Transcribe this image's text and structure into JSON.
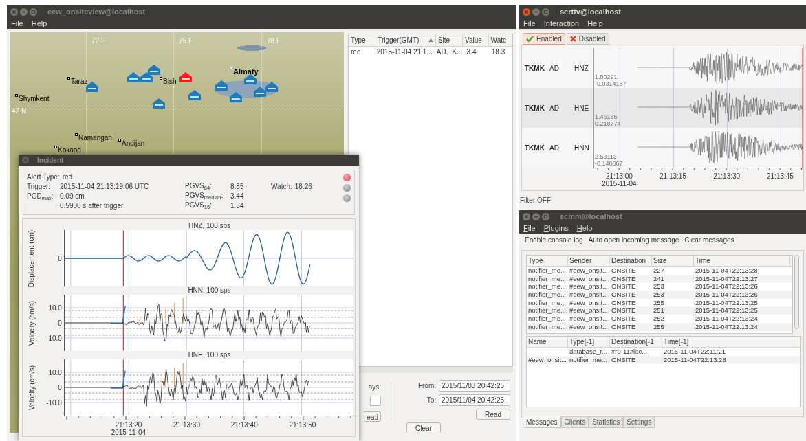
{
  "onsiteview": {
    "title": "eew_onsiteview@localhost",
    "active": false,
    "menu": [
      "File",
      "Help"
    ],
    "map": {
      "grid_labels": [
        "72 E",
        "75 E",
        "78 E",
        "42 N"
      ],
      "cities": [
        {
          "name": "Taraz",
          "capital": false
        },
        {
          "name": "Shymkent",
          "capital": false
        },
        {
          "name": "Bish",
          "capital": false
        },
        {
          "name": "Almaty",
          "capital": true
        },
        {
          "name": "Namangan",
          "capital": false
        },
        {
          "name": "Andijan",
          "capital": false
        },
        {
          "name": "Kokand",
          "capital": false
        }
      ],
      "stations": [
        {
          "color": "#1b7dc0"
        },
        {
          "color": "#1b7dc0"
        },
        {
          "color": "#1b7dc0"
        },
        {
          "color": "#1b7dc0"
        },
        {
          "color": "#ff1a1a"
        },
        {
          "color": "#1b7dc0"
        },
        {
          "color": "#1b7dc0"
        },
        {
          "color": "#1b7dc0"
        },
        {
          "color": "#1b7dc0"
        },
        {
          "color": "#1b7dc0"
        },
        {
          "color": "#1b7dc0"
        },
        {
          "color": "#1b7dc0"
        }
      ]
    },
    "table": {
      "columns": [
        {
          "label": "Type",
          "sorted": false
        },
        {
          "label": "Trigger(GMT)",
          "sorted": true
        },
        {
          "label": "Site",
          "sorted": false
        },
        {
          "label": "Value",
          "sorted": false
        },
        {
          "label": "Watc",
          "sorted": false
        }
      ],
      "rows": [
        [
          "red",
          "2015-11-04 21:1...",
          "AD.TK...",
          "3.4",
          "18.3"
        ]
      ]
    },
    "days_label": "ays:",
    "read_cut": "ead",
    "from_label": "From:",
    "from_value": "2015/11/03 20:42:25",
    "to_label": "To:",
    "to_value": "2015/11/04 20:42:25",
    "read_button": "Read",
    "clear_button": "Clear"
  },
  "incident": {
    "title": "Incident",
    "alert_type_label": "Alert Type:",
    "alert_type": "red",
    "trigger_label": "Trigger:",
    "trigger": "2015-11-04 21:13:19.06 UTC",
    "pgd_label": "PGD$_{max}$:",
    "pgd": "0.09 cm",
    "pgd_time": "0.5900 s after trigger",
    "pgvs": [
      {
        "label": "PGVS$_{84}$:",
        "value": "8.85"
      },
      {
        "label": "PGVS$_{median}$:",
        "value": "3.44"
      },
      {
        "label": "PGVS$_{16}$:",
        "value": "1.34"
      }
    ],
    "watch_label": "Watch:",
    "watch": "18.26",
    "lights": [
      {
        "on": true
      },
      {
        "on": false
      },
      {
        "on": false
      }
    ],
    "plots": [
      {
        "kind": "displacement",
        "title": "HNZ, 100 sps",
        "ylabel": "Displacement (cm)",
        "yticks": [
          "0"
        ]
      },
      {
        "kind": "velocity",
        "title": "HNN, 100 sps",
        "ylabel": "Velocity (cm/s)",
        "yticks": [
          "10.0",
          "0",
          "-10.0"
        ]
      },
      {
        "kind": "velocity",
        "title": "HNE, 100 sps",
        "ylabel": "Velocity (cm/s)",
        "yticks": [
          "10.0",
          "0",
          "-10.0"
        ]
      }
    ],
    "time_ticks": [
      "21:13:20",
      "21:13:30",
      "21:13:40",
      "21:13:50"
    ],
    "date": "2015-11-04"
  },
  "scrttv": {
    "title": "scrttv@localhost",
    "active": true,
    "menu": [
      "File",
      "Interaction",
      "Help"
    ],
    "tabs": [
      {
        "label": "Enabled",
        "selected": true,
        "kind": "check"
      },
      {
        "label": "Disabled",
        "selected": false,
        "kind": "cross"
      }
    ],
    "traces": [
      {
        "station": "TKMK",
        "network": "AD",
        "channel": "HNZ",
        "max": "1.00291",
        "min": "-0.0314187"
      },
      {
        "station": "TKMK",
        "network": "AD",
        "channel": "HNE",
        "max": "1.46186",
        "min": "0.218774"
      },
      {
        "station": "TKMK",
        "network": "AD",
        "channel": "HNN",
        "max": "2.53113",
        "min": "-0.146867"
      }
    ],
    "time_ticks": [
      "21:13:00",
      "21:13:15",
      "21:13:30",
      "21:13:45"
    ],
    "date": "2015-11-04",
    "status": "Filter OFF"
  },
  "scmm": {
    "title": "scmm@localhost",
    "active": false,
    "menu": [
      "File",
      "Plugins",
      "Help"
    ],
    "toolbar": [
      "Enable console log",
      "Auto open incoming message",
      "Clear messages"
    ],
    "messages": {
      "columns": [
        "Type",
        "Sender",
        "Destination",
        "Size",
        "Time"
      ],
      "rows": [
        [
          "notifier_me...",
          "#eew_onsit...",
          "ONSITE",
          "227",
          "2015-11-04T22:13:28"
        ],
        [
          "notifier_me...",
          "#eew_onsit...",
          "ONSITE",
          "241",
          "2015-11-04T22:13:27"
        ],
        [
          "notifier_me...",
          "#eew_onsit...",
          "ONSITE",
          "253",
          "2015-11-04T22:13:26"
        ],
        [
          "notifier_me...",
          "#eew_onsit...",
          "ONSITE",
          "253",
          "2015-11-04T22:13:26"
        ],
        [
          "notifier_me...",
          "#eew_onsit...",
          "ONSITE",
          "255",
          "2015-11-04T22:13:25"
        ],
        [
          "notifier_me...",
          "#eew_onsit...",
          "ONSITE",
          "251",
          "2015-11-04T22:13:25"
        ],
        [
          "notifier_me...",
          "#eew_onsit...",
          "ONSITE",
          "252",
          "2015-11-04T22:13:24"
        ],
        [
          "notifier_me...",
          "#eew_onsit...",
          "ONSITE",
          "255",
          "2015-11-04T22:13:24"
        ]
      ]
    },
    "clients": {
      "columns": [
        "Name",
        "Type[-1]",
        "Destination[-1",
        "Time[-1]"
      ],
      "rows": [
        {
          "type": "database_r...",
          "destination": "#r0-11#loc...",
          "time": "2015-11-04T22:11:21"
        },
        {
          "name": "#eew_onsit...",
          "type": "notifier_me...",
          "destination": "ONSITE",
          "time": "2015-11-04T22:13:28"
        }
      ]
    },
    "tabs": [
      {
        "label": "Messages",
        "selected": true
      },
      {
        "label": "Clients",
        "selected": false
      },
      {
        "label": "Statistics",
        "selected": false
      },
      {
        "label": "Settings",
        "selected": false
      }
    ]
  }
}
